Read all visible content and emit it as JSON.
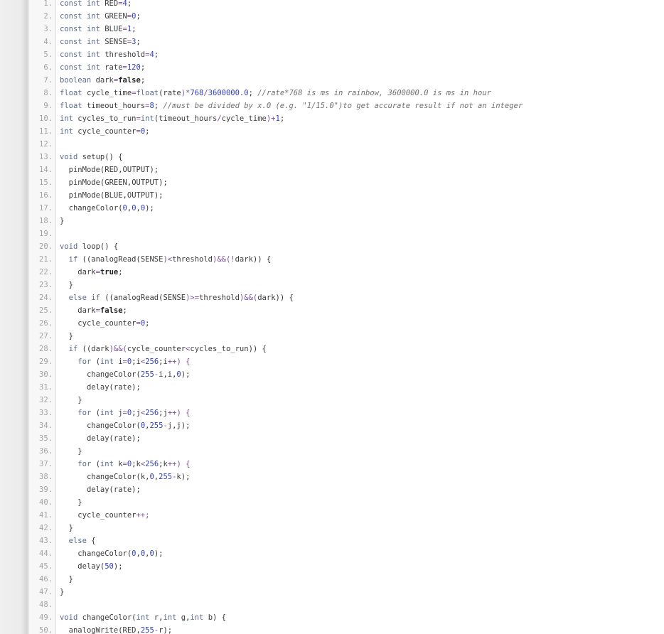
{
  "code": {
    "language": "arduino",
    "lines": [
      {
        "n": "1.",
        "text": "const int RED=4;"
      },
      {
        "n": "2.",
        "text": "const int GREEN=0;"
      },
      {
        "n": "3.",
        "text": "const int BLUE=1;"
      },
      {
        "n": "4.",
        "text": "const int SENSE=3;"
      },
      {
        "n": "5.",
        "text": "const int threshold=4;"
      },
      {
        "n": "6.",
        "text": "const int rate=120;"
      },
      {
        "n": "7.",
        "text": "boolean dark=false;"
      },
      {
        "n": "8.",
        "text": "float cycle_time=float(rate)*768/3600000.0; //rate*768 is ms in rainbow, 3600000.0 is ms in hour"
      },
      {
        "n": "9.",
        "text": "float timeout_hours=8; //must be divided by x.0 (e.g. \"1/15.0\")to get accurate result if not an integer"
      },
      {
        "n": "10.",
        "text": "int cycles_to_run=int(timeout_hours/cycle_time)+1;"
      },
      {
        "n": "11.",
        "text": "int cycle_counter=0;"
      },
      {
        "n": "12.",
        "text": ""
      },
      {
        "n": "13.",
        "text": "void setup() {"
      },
      {
        "n": "14.",
        "text": "  pinMode(RED,OUTPUT);"
      },
      {
        "n": "15.",
        "text": "  pinMode(GREEN,OUTPUT);"
      },
      {
        "n": "16.",
        "text": "  pinMode(BLUE,OUTPUT);"
      },
      {
        "n": "17.",
        "text": "  changeColor(0,0,0);"
      },
      {
        "n": "18.",
        "text": "}"
      },
      {
        "n": "19.",
        "text": ""
      },
      {
        "n": "20.",
        "text": "void loop() {"
      },
      {
        "n": "21.",
        "text": "  if ((analogRead(SENSE)<threshold)&&(!dark)) {"
      },
      {
        "n": "22.",
        "text": "    dark=true;"
      },
      {
        "n": "23.",
        "text": "  }"
      },
      {
        "n": "24.",
        "text": "  else if ((analogRead(SENSE)>=threshold)&&(dark)) {"
      },
      {
        "n": "25.",
        "text": "    dark=false;"
      },
      {
        "n": "26.",
        "text": "    cycle_counter=0;"
      },
      {
        "n": "27.",
        "text": "  }"
      },
      {
        "n": "28.",
        "text": "  if ((dark)&&(cycle_counter<cycles_to_run)) {"
      },
      {
        "n": "29.",
        "text": "    for (int i=0;i<256;i++) {"
      },
      {
        "n": "30.",
        "text": "      changeColor(255-i,i,0);"
      },
      {
        "n": "31.",
        "text": "      delay(rate);"
      },
      {
        "n": "32.",
        "text": "    }"
      },
      {
        "n": "33.",
        "text": "    for (int j=0;j<256;j++) {"
      },
      {
        "n": "34.",
        "text": "      changeColor(0,255-j,j);"
      },
      {
        "n": "35.",
        "text": "      delay(rate);"
      },
      {
        "n": "36.",
        "text": "    }"
      },
      {
        "n": "37.",
        "text": "    for (int k=0;k<256;k++) {"
      },
      {
        "n": "38.",
        "text": "      changeColor(k,0,255-k);"
      },
      {
        "n": "39.",
        "text": "      delay(rate);"
      },
      {
        "n": "40.",
        "text": "    }"
      },
      {
        "n": "41.",
        "text": "    cycle_counter++;"
      },
      {
        "n": "42.",
        "text": "  }"
      },
      {
        "n": "43.",
        "text": "  else {"
      },
      {
        "n": "44.",
        "text": "    changeColor(0,0,0);"
      },
      {
        "n": "45.",
        "text": "    delay(50);"
      },
      {
        "n": "46.",
        "text": "  }"
      },
      {
        "n": "47.",
        "text": "}"
      },
      {
        "n": "48.",
        "text": ""
      },
      {
        "n": "49.",
        "text": "void changeColor(int r,int g,int b) {"
      },
      {
        "n": "50.",
        "text": "  analogWrite(RED,255-r);"
      }
    ]
  },
  "colors": {
    "page_background": "#ffffff",
    "gutter_background": "#f7f7f7",
    "line_number": "#a3a3a3",
    "keyword": "#5a6a8c",
    "number": "#2f3fb8",
    "comment": "#6f6f6f"
  }
}
